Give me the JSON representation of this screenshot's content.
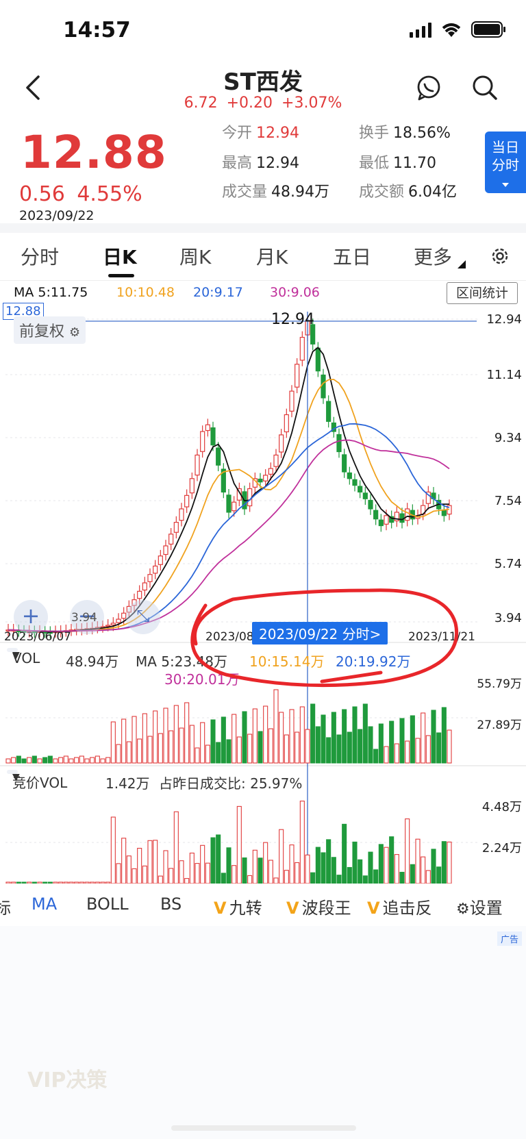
{
  "status": {
    "time": "14:57"
  },
  "header": {
    "title": "ST西发",
    "sub_quote": "6.72 +0.20 +3.07%"
  },
  "quote": {
    "price": "12.88",
    "change": "0.56",
    "change_pct": "4.55%",
    "date": "2023/09/22",
    "open_label": "今开",
    "open": "12.94",
    "turnover_label": "换手",
    "turnover": "18.56%",
    "high_label": "最高",
    "high": "12.94",
    "low_label": "最低",
    "low": "11.70",
    "volume_label": "成交量",
    "volume": "48.94万",
    "amount_label": "成交额",
    "amount": "6.04亿",
    "intraday_btn": [
      "当日",
      "分时"
    ]
  },
  "tabs": [
    "分时",
    "日K",
    "周K",
    "月K",
    "五日",
    "更多"
  ],
  "active_tab": "日K",
  "ma_legend": {
    "ma5": "MA 5:11.75",
    "ma10": "10:10.48",
    "ma20": "20:9.17",
    "ma30": "30:9.06"
  },
  "range_stats": "区间统计",
  "adjust_label": "前复权",
  "current_price_tag": "12.88",
  "peak_label": "12.94",
  "y_labels": [
    "12.94",
    "11.14",
    "9.34",
    "7.54",
    "5.74",
    "3.94"
  ],
  "min_label": "3.94",
  "x_labels": {
    "start": "2023/06/07",
    "mid": "2023/08",
    "end": "2023/11/21"
  },
  "date_pill": "2023/09/22 分时>",
  "zoom": {
    "plus": "+",
    "minus": "−"
  },
  "vol": {
    "selector": "VOL",
    "value": "48.94万",
    "ma5": "MA 5:23.48万",
    "ma10": "10:15.14万",
    "ma20": "20:19.92万",
    "ma30": "30:20.01万",
    "y_top": "55.79万",
    "y_mid": "27.89万"
  },
  "auction": {
    "selector": "竞价VOL",
    "value": "1.42万",
    "ratio": "占昨日成交比: 25.97%",
    "y_top": "4.48万",
    "y_mid": "2.24万"
  },
  "indicators": [
    "标",
    "MA",
    "BOLL",
    "BS",
    "九转",
    "波段王",
    "追击反",
    "设置"
  ],
  "ad": {
    "tag": "广告",
    "faded_text": "VIP决策"
  },
  "colors": {
    "up": "#e03a3a",
    "down": "#1f9a3c",
    "ma5": "#111111",
    "ma10": "#f0a21e",
    "ma20": "#2b66d8",
    "ma30": "#c0309b",
    "accent": "#1e6fe8"
  }
}
